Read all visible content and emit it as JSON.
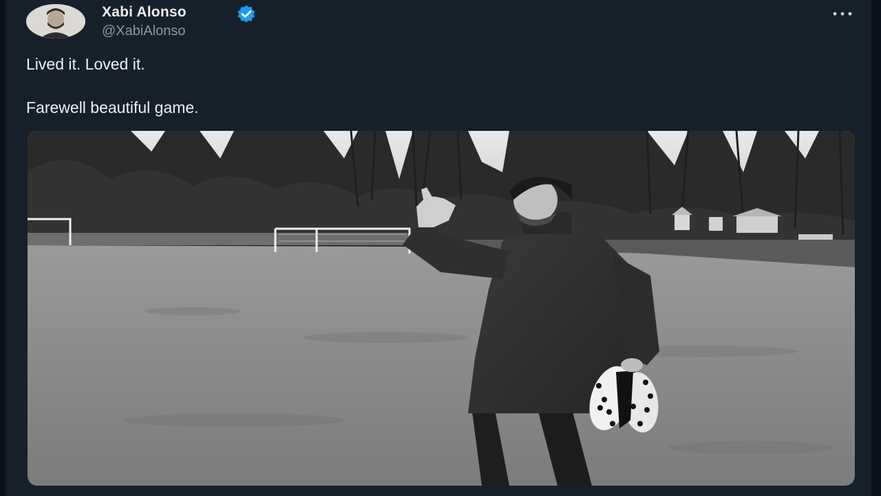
{
  "tweet": {
    "author": {
      "display_name": "Xabi Alonso",
      "handle": "@XabiAlonso",
      "verified": true,
      "avatar_icon": "profile-photo"
    },
    "text_line_1": "Lived it. Loved it.",
    "text_line_2": "Farewell beautiful game.",
    "more_icon": "more-horizontal-icon",
    "media": {
      "type": "photo",
      "style": "black-and-white"
    }
  },
  "colors": {
    "background": "#16202b",
    "text_primary": "#eef0f2",
    "text_secondary": "#8b98a5",
    "verified_badge": "#1d9bf0"
  }
}
